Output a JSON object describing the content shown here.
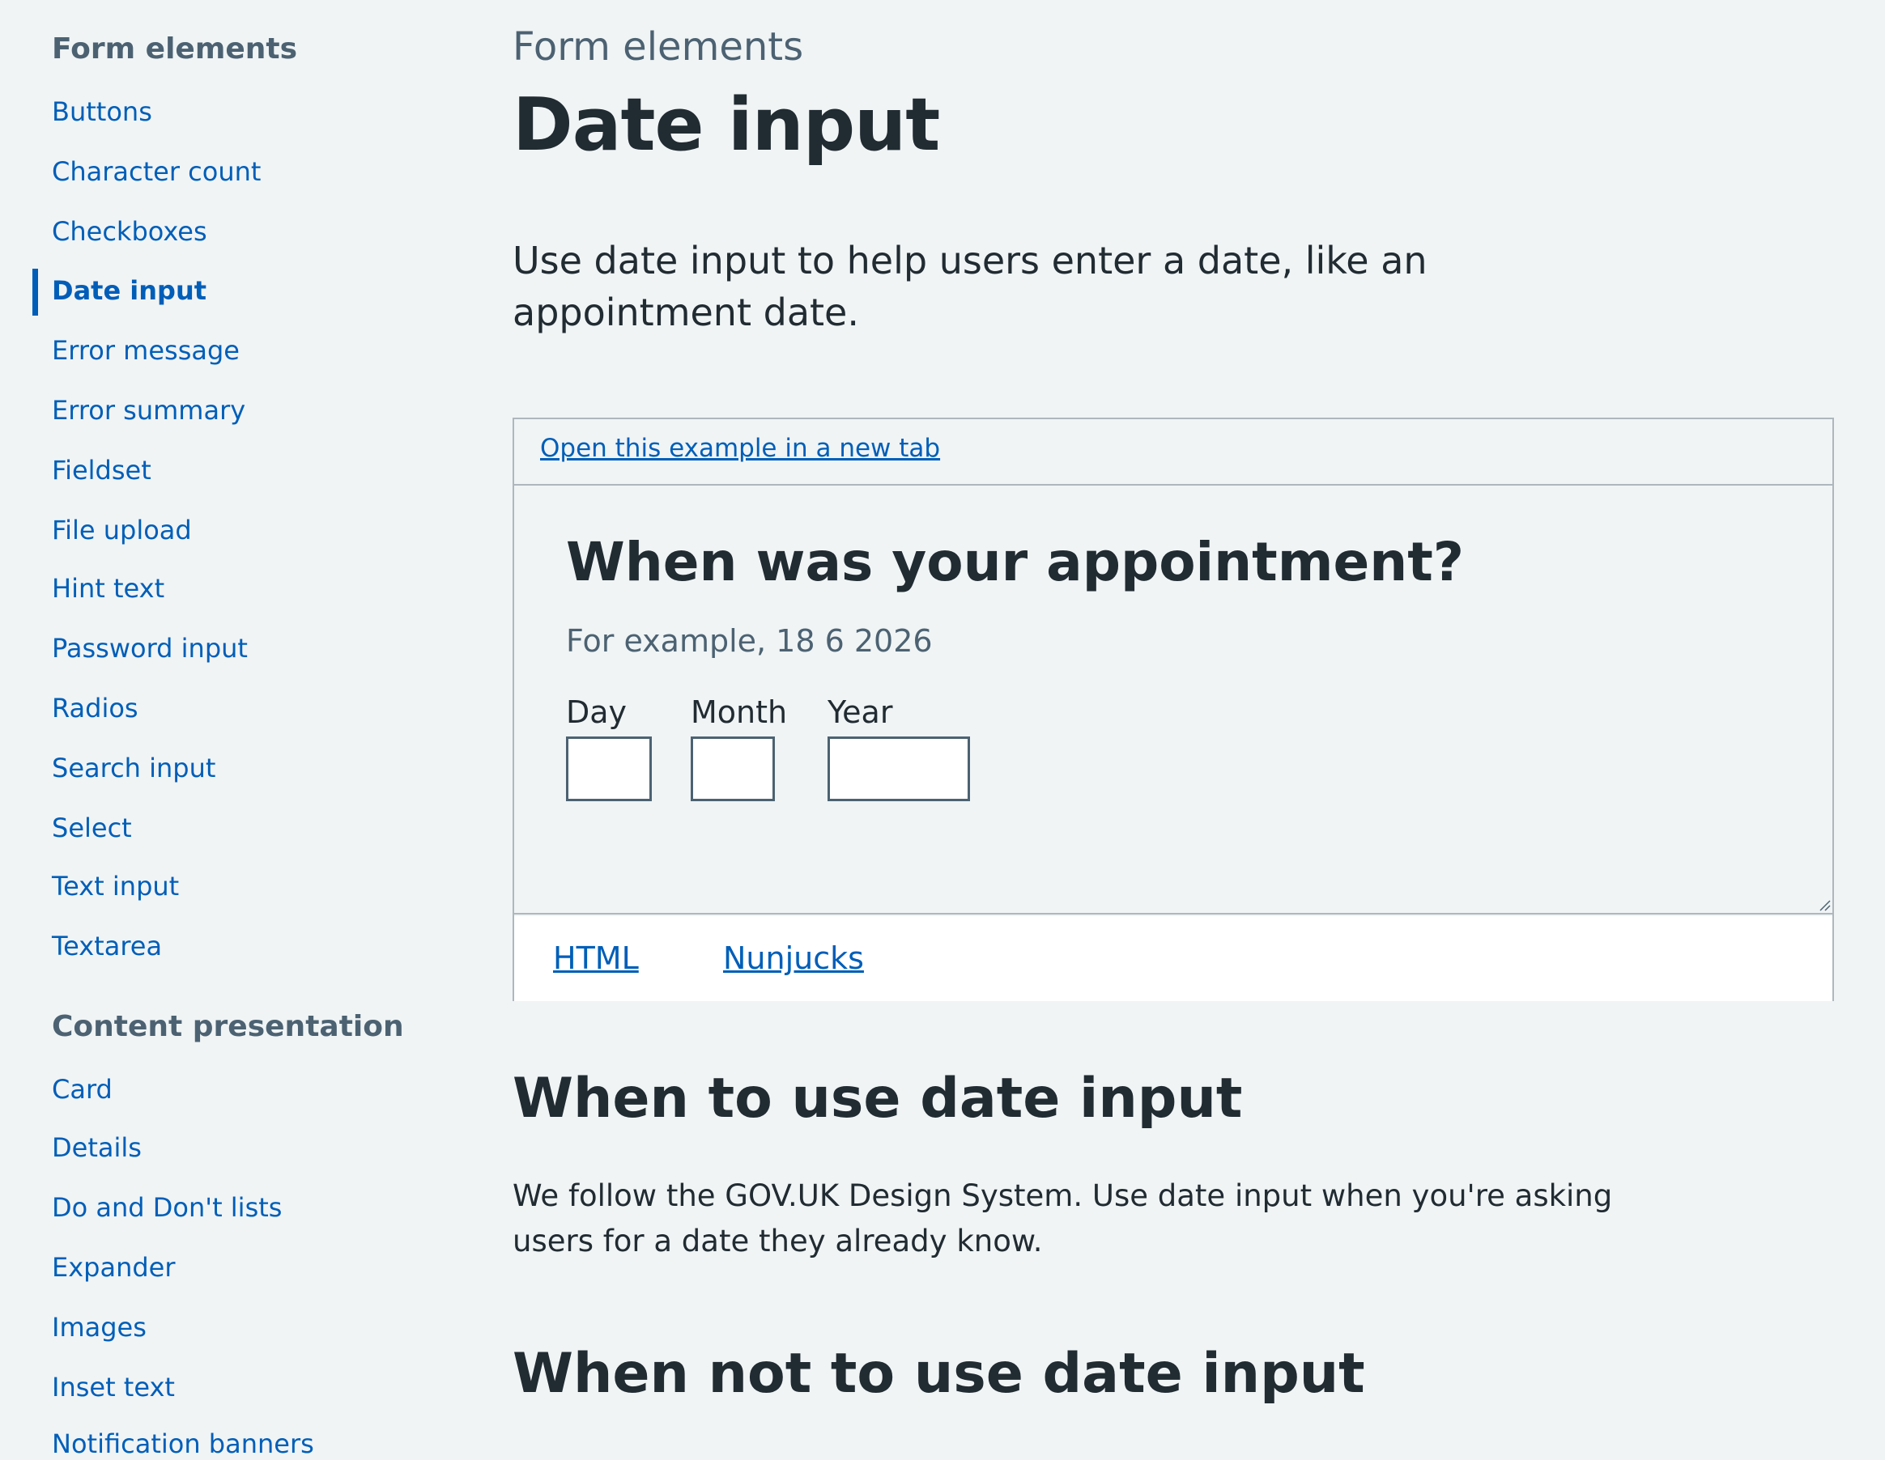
{
  "sidebar": {
    "groups": [
      {
        "heading": "Form elements",
        "items": [
          {
            "label": "Buttons"
          },
          {
            "label": "Character count"
          },
          {
            "label": "Checkboxes"
          },
          {
            "label": "Date input",
            "active": true
          },
          {
            "label": "Error message"
          },
          {
            "label": "Error summary"
          },
          {
            "label": "Fieldset"
          },
          {
            "label": "File upload"
          },
          {
            "label": "Hint text"
          },
          {
            "label": "Password input"
          },
          {
            "label": "Radios"
          },
          {
            "label": "Search input"
          },
          {
            "label": "Select"
          },
          {
            "label": "Text input"
          },
          {
            "label": "Textarea"
          }
        ]
      },
      {
        "heading": "Content presentation",
        "items": [
          {
            "label": "Card"
          },
          {
            "label": "Details"
          },
          {
            "label": "Do and Don't lists"
          },
          {
            "label": "Expander"
          },
          {
            "label": "Images"
          },
          {
            "label": "Inset text"
          },
          {
            "label": "Notification banners"
          }
        ]
      }
    ]
  },
  "main": {
    "caption": "Form elements",
    "title": "Date input",
    "lede": "Use date input to help users enter a date, like an appointment date.",
    "example": {
      "open_link": "Open this example in a new tab",
      "question": "When was your appointment?",
      "hint": "For example, 18 6 2026",
      "fields": [
        {
          "label": "Day",
          "value": ""
        },
        {
          "label": "Month",
          "value": ""
        },
        {
          "label": "Year",
          "value": ""
        }
      ],
      "tabs": [
        {
          "label": "HTML"
        },
        {
          "label": "Nunjucks"
        }
      ]
    },
    "sections": [
      {
        "heading": "When to use date input",
        "text": "We follow the GOV.UK Design System. Use date input when you're asking users for a date they already know."
      },
      {
        "heading": "When not to use date input"
      }
    ]
  },
  "colors": {
    "background": "#f0f4f5",
    "link": "#005eb8",
    "text": "#212b32",
    "secondary_text": "#4c6272",
    "border": "#aeb7bd"
  }
}
